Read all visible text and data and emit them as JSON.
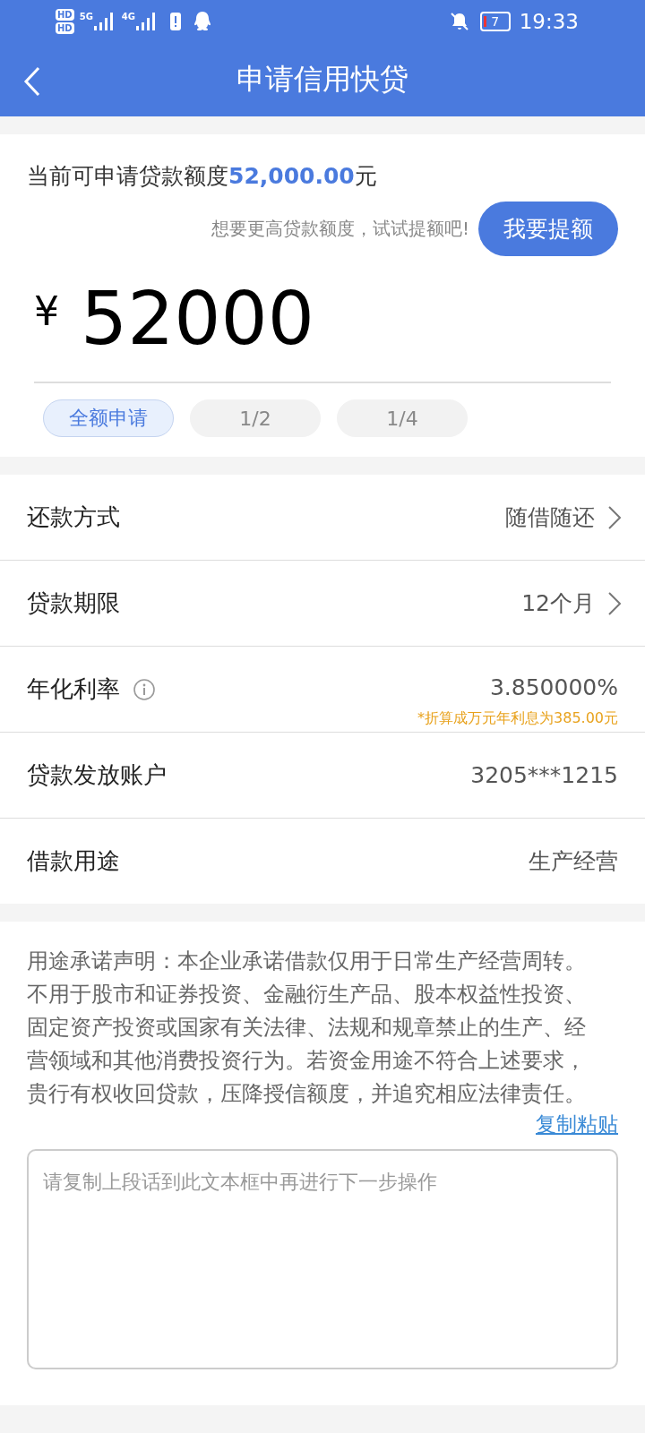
{
  "status_bar": {
    "hd_labels": [
      "HD",
      "HD"
    ],
    "signals": [
      {
        "network": "5G"
      },
      {
        "network": "4G"
      }
    ],
    "battery": "7",
    "time": "19:33"
  },
  "header": {
    "title": "申请信用快贷"
  },
  "quota": {
    "prefix": "当前可申请贷款额度",
    "amount": "52,000.00",
    "suffix": "元",
    "hint": "想要更高贷款额度，试试提额吧!",
    "raise_button": "我要提额",
    "currency": "¥",
    "value": "52000",
    "options": [
      {
        "label": "全额申请",
        "selected": true
      },
      {
        "label": "1/2",
        "selected": false
      },
      {
        "label": "1/4",
        "selected": false
      }
    ]
  },
  "rows": [
    {
      "label": "还款方式",
      "value": "随借随还",
      "chevron": true
    },
    {
      "label": "贷款期限",
      "value": "12个月",
      "chevron": true
    },
    {
      "label": "年化利率",
      "value": "3.850000%",
      "info": true,
      "note": "*折算成万元年利息为385.00元"
    },
    {
      "label": "贷款发放账户",
      "value": "3205***1215"
    },
    {
      "label": "借款用途",
      "value": "生产经营"
    }
  ],
  "statement": {
    "text": "用途承诺声明：本企业承诺借款仅用于日常生产经营周转。不用于股市和证券投资、金融衍生产品、股本权益性投资、固定资产投资或国家有关法律、法规和规章禁止的生产、经营领域和其他消费投资行为。若资金用途不符合上述要求，贵行有权收回贷款，压降授信额度，并追究相应法律责任。",
    "copy_link": "复制粘贴",
    "placeholder": "请复制上段话到此文本框中再进行下一步操作"
  }
}
